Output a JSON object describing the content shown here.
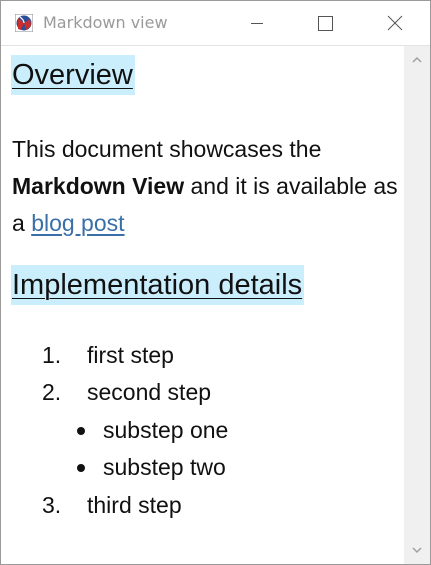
{
  "window": {
    "title": "Markdown view",
    "icon": "racket-logo-icon",
    "controls": [
      "minimize-icon",
      "maximize-icon",
      "close-icon"
    ]
  },
  "document": {
    "heading1": "Overview",
    "paragraph": {
      "before_bold": "This document showcases the ",
      "bold": "Markdown View",
      "after_bold": " and it is available as a ",
      "link": "blog post"
    },
    "heading2": "Implementation details",
    "ordered_list": [
      {
        "number": "1.",
        "text": "first step"
      },
      {
        "number": "2.",
        "text": "second step",
        "sub_items": [
          "substep one",
          "substep two"
        ]
      },
      {
        "number": "3.",
        "text": "third step"
      }
    ]
  },
  "colors": {
    "heading_highlight": "#cbeefd",
    "link": "#3a6fa8",
    "title_text": "#9a9a9a"
  }
}
